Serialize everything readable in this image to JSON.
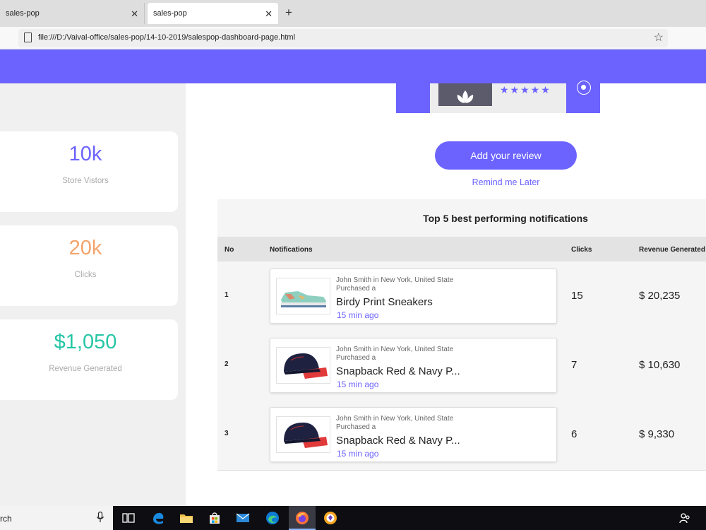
{
  "browser": {
    "tabs": [
      {
        "label": "sales-pop",
        "close": "✕"
      },
      {
        "label": "sales-pop",
        "close": "✕"
      }
    ],
    "new_tab": "+",
    "url": "file:///D:/Vaival-office/sales-pop/14-10-2019/salespop-dashboard-page.html",
    "bookmark_star": "☆"
  },
  "stats": [
    {
      "value": "10k",
      "label": "Store Vistors",
      "color": "#6c63ff"
    },
    {
      "value": "20k",
      "label": "Clicks",
      "color": "#f4a46c"
    },
    {
      "value": "$1,050",
      "label": "Revenue Generated",
      "color": "#26c6a6"
    }
  ],
  "review": {
    "stars": "★★★★★",
    "button": "Add your review",
    "remind": "Remind me Later"
  },
  "table": {
    "title": "Top 5 best performing notifications",
    "headers": {
      "no": "No",
      "notifications": "Notifications",
      "clicks": "Clicks",
      "revenue": "Revenue Generated"
    },
    "rows": [
      {
        "no": "1",
        "who": "John Smith in New York, United State",
        "purchased": "Purchased a",
        "product": "Birdy Print Sneakers",
        "time": "15 min ago",
        "clicks": "15",
        "revenue": "$ 20,235"
      },
      {
        "no": "2",
        "who": "John Smith in New York, United State",
        "purchased": "Purchased a",
        "product": "Snapback Red & Navy P...",
        "time": "15 min ago",
        "clicks": "7",
        "revenue": "$ 10,630"
      },
      {
        "no": "3",
        "who": "John Smith in New York, United State",
        "purchased": "Purchased a",
        "product": "Snapback Red & Navy P...",
        "time": "15 min ago",
        "clicks": "6",
        "revenue": "$ 9,330"
      }
    ]
  },
  "taskbar": {
    "search_text": "rch",
    "icons": [
      "task-view-icon",
      "edge-icon",
      "file-explorer-icon",
      "store-icon",
      "mail-icon",
      "edge-chromium-icon",
      "firefox-icon",
      "brave-icon",
      "people-icon"
    ]
  },
  "colors": {
    "accent": "#6c63ff"
  }
}
